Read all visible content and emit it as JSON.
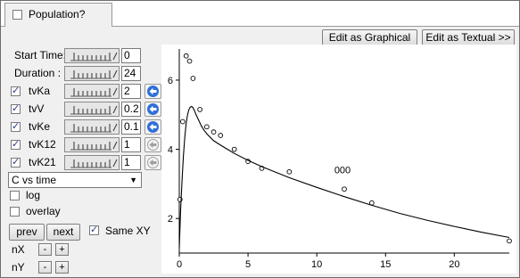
{
  "population": {
    "label": "Population?",
    "checked": false
  },
  "header": {
    "edit_graphical": "Edit as Graphical >>",
    "edit_textual": "Edit as Textual >>"
  },
  "params": [
    {
      "label": "Start Time:",
      "value": "0",
      "checkbox": false,
      "arrow": "none"
    },
    {
      "label": "Duration :",
      "value": "24",
      "checkbox": false,
      "arrow": "none"
    },
    {
      "label": "tvKa",
      "value": "2",
      "checkbox": true,
      "arrow": "blue"
    },
    {
      "label": "tvV",
      "value": "0.2",
      "checkbox": true,
      "arrow": "blue"
    },
    {
      "label": "tvKe",
      "value": "0.1",
      "checkbox": true,
      "arrow": "blue"
    },
    {
      "label": "tvK12",
      "value": "1",
      "checkbox": true,
      "arrow": "gray"
    },
    {
      "label": "tvK21",
      "value": "1",
      "checkbox": true,
      "arrow": "gray"
    }
  ],
  "plot_select": {
    "value": "C vs time"
  },
  "options": {
    "log": "log",
    "overlay": "overlay",
    "log_checked": false,
    "overlay_checked": false
  },
  "nav": {
    "prev": "prev",
    "next": "next",
    "same_xy": "Same XY",
    "same_xy_checked": true
  },
  "grid_controls": {
    "nx_label": "nX",
    "ny_label": "nY",
    "minus": "-",
    "plus": "+"
  },
  "colors": {
    "accent_blue": "#2f6fd6",
    "arrow_gray": "#a0a0a0"
  },
  "chart_data": {
    "type": "scatter",
    "title": "",
    "xlabel": "",
    "ylabel": "",
    "xlim": [
      0,
      24
    ],
    "ylim": [
      1.0,
      6.9
    ],
    "xticks": [
      "0",
      "5",
      "10",
      "15",
      "20"
    ],
    "yticks": [
      "2",
      "4",
      "6"
    ],
    "annotation": {
      "text": "000",
      "x": 12,
      "y": 3.3
    },
    "series": [
      {
        "type": "scatter",
        "x": [
          0.05,
          0.25,
          0.5,
          0.75,
          1.0,
          1.5,
          2.0,
          2.5,
          3.0,
          4.0,
          5.0,
          6.0,
          8.0,
          12.0,
          14.0,
          24.0
        ],
        "y": [
          2.55,
          4.8,
          6.7,
          6.55,
          6.05,
          5.15,
          4.65,
          4.5,
          4.4,
          4.0,
          3.65,
          3.45,
          3.35,
          2.85,
          2.45,
          1.35
        ]
      },
      {
        "type": "line",
        "x": [
          0,
          0.1,
          0.2,
          0.3,
          0.4,
          0.5,
          0.6,
          0.7,
          0.8,
          0.9,
          1.0,
          1.1,
          1.2,
          1.4,
          1.6,
          1.8,
          2.0,
          2.5,
          3.0,
          4.0,
          5.0,
          6.0,
          8.0,
          10.0,
          12.0,
          14.0,
          16.0,
          18.0,
          20.0,
          22.0,
          24.0
        ],
        "y": [
          1.15,
          2.25,
          3.1,
          3.8,
          4.35,
          4.75,
          5.0,
          5.15,
          5.22,
          5.24,
          5.2,
          5.12,
          5.02,
          4.85,
          4.68,
          4.55,
          4.45,
          4.25,
          4.12,
          3.88,
          3.68,
          3.5,
          3.18,
          2.9,
          2.63,
          2.38,
          2.15,
          1.95,
          1.77,
          1.6,
          1.45
        ]
      }
    ]
  }
}
